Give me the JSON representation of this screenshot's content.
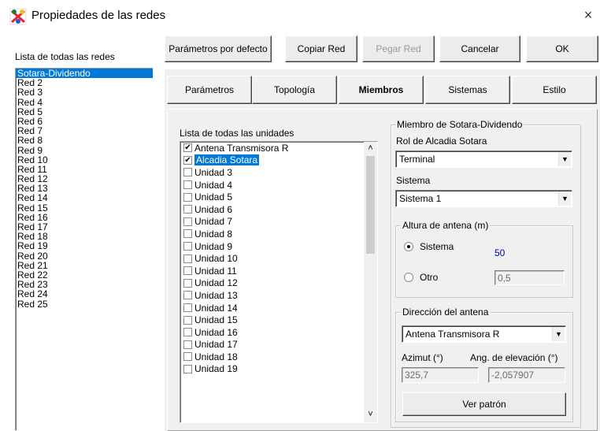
{
  "window": {
    "title": "Propiedades de las redes",
    "close_glyph": "×",
    "icon": "network-app-icon"
  },
  "networks": {
    "label": "Lista de todas las redes",
    "items": [
      "Sotara-Dividendo",
      "Red  2",
      "Red  3",
      "Red  4",
      "Red  5",
      "Red  6",
      "Red  7",
      "Red  8",
      "Red  9",
      "Red 10",
      "Red 11",
      "Red 12",
      "Red 13",
      "Red 14",
      "Red 15",
      "Red 16",
      "Red 17",
      "Red 18",
      "Red 19",
      "Red 20",
      "Red 21",
      "Red 22",
      "Red 23",
      "Red 24",
      "Red 25"
    ],
    "selected_index": 0
  },
  "toolbar": {
    "defaults_label": "Parámetros por defecto",
    "copy_label": "Copiar Red",
    "paste_label": "Pegar Red",
    "cancel_label": "Cancelar",
    "ok_label": "OK"
  },
  "tabs": [
    {
      "label": "Parámetros"
    },
    {
      "label": "Topología"
    },
    {
      "label": "Miembros"
    },
    {
      "label": "Sistemas"
    },
    {
      "label": "Estilo"
    }
  ],
  "active_tab": "Miembros",
  "units": {
    "label": "Lista de todas las unidades",
    "items": [
      {
        "name": "Antena Transmisora R",
        "checked": true
      },
      {
        "name": "Alcadia Sotara",
        "checked": true,
        "selected": true
      },
      {
        "name": "Unidad   3",
        "checked": false
      },
      {
        "name": "Unidad   4",
        "checked": false
      },
      {
        "name": "Unidad   5",
        "checked": false
      },
      {
        "name": "Unidad   6",
        "checked": false
      },
      {
        "name": "Unidad   7",
        "checked": false
      },
      {
        "name": "Unidad   8",
        "checked": false
      },
      {
        "name": "Unidad   9",
        "checked": false
      },
      {
        "name": "Unidad  10",
        "checked": false
      },
      {
        "name": "Unidad  11",
        "checked": false
      },
      {
        "name": "Unidad  12",
        "checked": false
      },
      {
        "name": "Unidad  13",
        "checked": false
      },
      {
        "name": "Unidad  14",
        "checked": false
      },
      {
        "name": "Unidad  15",
        "checked": false
      },
      {
        "name": "Unidad  16",
        "checked": false
      },
      {
        "name": "Unidad  17",
        "checked": false
      },
      {
        "name": "Unidad  18",
        "checked": false
      },
      {
        "name": "Unidad  19",
        "checked": false
      }
    ],
    "scroll_up": "˄",
    "scroll_down": "˅"
  },
  "member": {
    "group_title": "Miembro de Sotara-Dividendo",
    "role_label": "Rol de Alcadia Sotara",
    "role_value": "Terminal",
    "system_label": "Sistema",
    "system_value": "Sistema  1",
    "height_group": "Altura de antena (m)",
    "radio_system_label": "Sistema",
    "system_height_value": "50",
    "radio_other_label": "Otro",
    "other_value": "0,5",
    "selected_height_option": "Sistema",
    "direction_group": "Dirección del antena",
    "direction_value": "Antena Transmisora R",
    "azimuth_label": "Azimut (°)",
    "elevation_label": "Ang. de elevación (°)",
    "azimuth_value": "325,7",
    "elevation_value": "-2,057907",
    "pattern_button": "Ver patrón",
    "combo_arrow_glyph": "▼"
  },
  "colors": {
    "selection": "#0078d7",
    "value_blue": "#0000cc"
  }
}
